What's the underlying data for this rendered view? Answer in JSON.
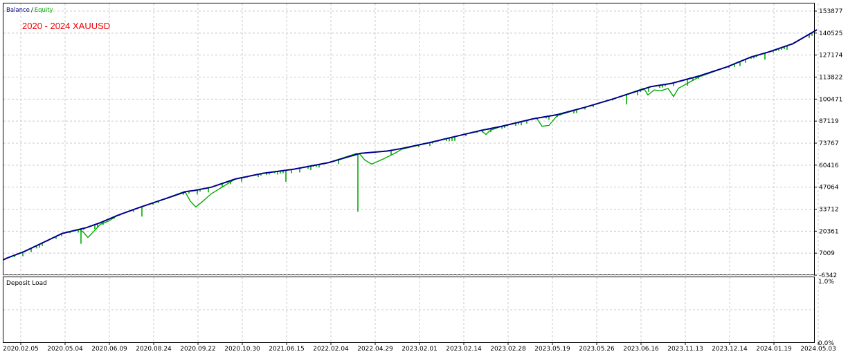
{
  "legend": {
    "balance_label": "Balance",
    "separator": "/",
    "equity_label": "Equity",
    "balance_color": "#00008b",
    "equity_color": "#00aa00"
  },
  "title": {
    "text": "2020 - 2024 XAUUSD",
    "color": "#ee0000"
  },
  "deposit_panel": {
    "label": "Deposit Load",
    "ticks": [
      "1.0%",
      "0.0%"
    ]
  },
  "y_ticks": [
    "153877",
    "140525",
    "127174",
    "113822",
    "100471",
    "87119",
    "73767",
    "60416",
    "47064",
    "33712",
    "20361",
    "7009",
    "-6342"
  ],
  "x_ticks": [
    "2020.02.05",
    "2020.05.04",
    "2020.06.09",
    "2020.08.24",
    "2020.09.22",
    "2020.10.30",
    "2021.06.15",
    "2022.02.04",
    "2022.04.29",
    "2023.02.01",
    "2023.02.14",
    "2023.02.28",
    "2023.05.19",
    "2023.05.26",
    "2023.06.16",
    "2023.11.13",
    "2023.12.14",
    "2024.01.19",
    "2024.05.03"
  ],
  "chart_data": {
    "type": "line",
    "title": "2020 - 2024 XAUUSD",
    "ylim": [
      -6342,
      153877
    ],
    "grid": true,
    "legend_placement": "top-left",
    "balance": {
      "name": "Balance",
      "x": [
        0,
        5,
        30,
        60,
        85,
        110,
        120,
        140,
        165,
        195,
        230,
        265,
        275,
        300,
        335,
        375,
        420,
        470,
        515,
        555,
        575,
        615,
        660,
        690,
        720,
        765,
        800,
        840,
        880,
        935,
        965,
        1005,
        1045,
        1080,
        1105,
        1140,
        1175
      ],
      "y": [
        3000,
        4000,
        8000,
        14000,
        19000,
        21500,
        22500,
        25500,
        30000,
        34500,
        39500,
        44500,
        45000,
        47000,
        52000,
        55500,
        58000,
        62000,
        67500,
        69000,
        70500,
        74000,
        78500,
        81500,
        84000,
        88500,
        91000,
        95500,
        100500,
        108000,
        110000,
        114500,
        120000,
        126000,
        129000,
        134000,
        142500
      ]
    },
    "equity": {
      "name": "Equity",
      "x": [
        0,
        5,
        30,
        60,
        85,
        110,
        116,
        122,
        130,
        140,
        152,
        165,
        195,
        230,
        262,
        270,
        278,
        288,
        300,
        335,
        375,
        420,
        470,
        510,
        515,
        522,
        532,
        548,
        565,
        575,
        615,
        660,
        690,
        697,
        703,
        720,
        765,
        770,
        778,
        788,
        800,
        840,
        880,
        925,
        931,
        940,
        950,
        960,
        968,
        975,
        1005,
        1045,
        1080,
        1105,
        1140,
        1175
      ],
      "y": [
        3000,
        4000,
        8000,
        14000,
        19000,
        21500,
        19500,
        16500,
        20000,
        24500,
        26500,
        30000,
        34500,
        39500,
        44500,
        38500,
        35000,
        38500,
        43000,
        52000,
        55500,
        58000,
        62000,
        67500,
        67000,
        63500,
        61000,
        64000,
        67500,
        70000,
        74000,
        78500,
        81500,
        79000,
        81500,
        84000,
        88500,
        89000,
        84000,
        84500,
        90500,
        95500,
        100500,
        107000,
        103000,
        106000,
        105500,
        107000,
        102000,
        107000,
        114000,
        120000,
        126000,
        129000,
        134000,
        142500
      ]
    }
  }
}
